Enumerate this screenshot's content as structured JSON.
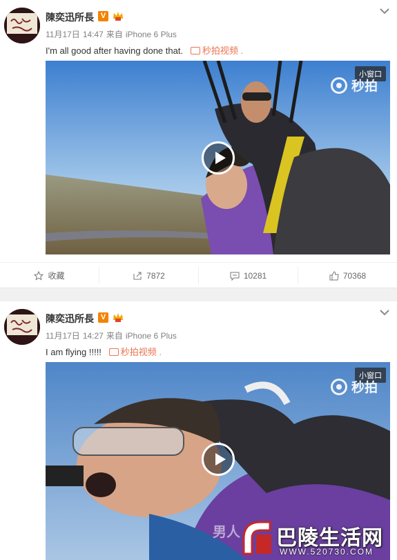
{
  "posts": [
    {
      "author": "陳奕迅所長",
      "date": "11月17日",
      "time": "14:47",
      "via_prefix": "来自",
      "device": "iPhone 6 Plus",
      "text": "I'm all good after having done that.",
      "video_link": "秒拍视频",
      "trailing": ".",
      "mini_window": "小窗口",
      "watermark": "秒拍",
      "actions": {
        "favorite": "收藏",
        "repost": "7872",
        "comment": "10281",
        "like": "70368"
      }
    },
    {
      "author": "陳奕迅所長",
      "date": "11月17日",
      "time": "14:27",
      "via_prefix": "来自",
      "device": "iPhone 6 Plus",
      "text": "I am flying !!!!!",
      "video_link": "秒拍视频",
      "trailing": ".",
      "mini_window": "小窗口",
      "watermark": "秒拍"
    }
  ],
  "overlay": {
    "site_name": "巴陵生活网",
    "site_url": "WWW.520730.COM",
    "ghost_text": "男人"
  },
  "colors": {
    "accent": "#eb7350",
    "verified": "#f28400",
    "sky": "#6fa3d8",
    "jumpsuit": "#6a3fa0"
  },
  "icons": [
    "chevron-down-icon",
    "verified-icon",
    "crown-icon",
    "video-icon",
    "star-icon",
    "repost-icon",
    "comment-icon",
    "like-icon",
    "play-icon",
    "miaopai-logo-icon"
  ]
}
